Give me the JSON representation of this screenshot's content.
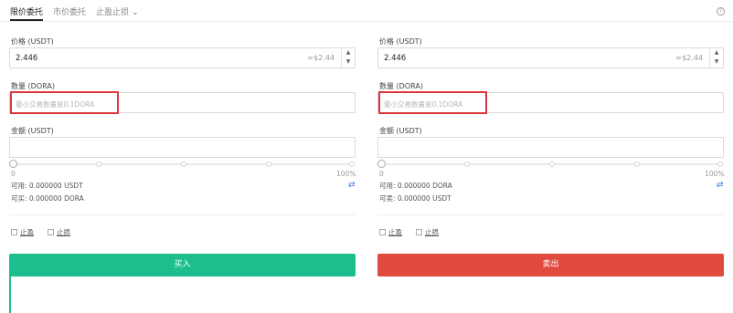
{
  "tabs": {
    "limit": "限价委托",
    "market": "市价委托",
    "stop": "止盈止损",
    "help": "?"
  },
  "colors": {
    "buy": "#1dbe8d",
    "sell": "#e04a3f",
    "highlight": "#d9373b",
    "swap": "#3b76e0"
  },
  "buy": {
    "price_label": "价格 (USDT)",
    "price_value": "2.446",
    "price_approx": "≈$2.44",
    "qty_label": "数量 (DORA)",
    "qty_placeholder": "最小交易数量是0.1DORA",
    "amount_label": "金额 (USDT)",
    "slider_min": "0",
    "slider_max": "100%",
    "slider_level": 0,
    "avail1": "可用: 0.000000 USDT",
    "avail2": "可买: 0.000000 DORA",
    "swap_icon": "⇄",
    "chk_stop_profit": "止盈",
    "chk_stop_loss": "止损",
    "action": "买入"
  },
  "sell": {
    "price_label": "价格 (USDT)",
    "price_value": "2.446",
    "price_approx": "≈$2.44",
    "qty_label": "数量 (DORA)",
    "qty_placeholder": "最小交易数量是0.1DORA",
    "amount_label": "金额 (USDT)",
    "slider_min": "0",
    "slider_max": "100%",
    "slider_level": 0,
    "avail1": "可用: 0.000000 DORA",
    "avail2": "可卖: 0.000000 USDT",
    "swap_icon": "⇄",
    "chk_stop_profit": "止盈",
    "chk_stop_loss": "止损",
    "action": "卖出"
  }
}
